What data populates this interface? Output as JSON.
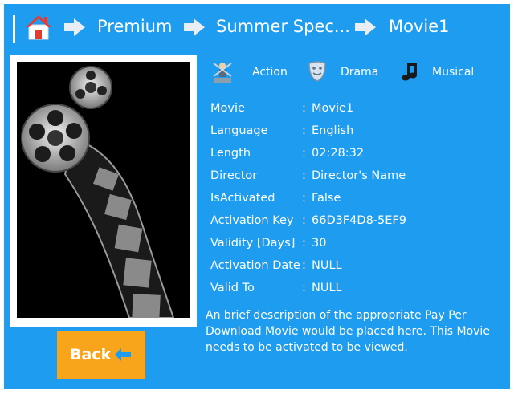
{
  "breadcrumb": {
    "items": [
      "Premium",
      "Summer Spec...",
      "Movie1"
    ]
  },
  "genres": [
    {
      "label": "Action",
      "icon": "action-figure-icon"
    },
    {
      "label": "Drama",
      "icon": "drama-mask-icon"
    },
    {
      "label": "Musical",
      "icon": "music-note-icon"
    }
  ],
  "details": [
    {
      "key": "Movie",
      "value": "Movie1"
    },
    {
      "key": "Language",
      "value": "English"
    },
    {
      "key": "Length",
      "value": "02:28:32"
    },
    {
      "key": "Director",
      "value": "Director's Name"
    },
    {
      "key": "IsActivated",
      "value": "False"
    },
    {
      "key": "Activation Key",
      "value": "66D3F4D8-5EF9"
    },
    {
      "key": "Validity [Days]",
      "value": "30"
    },
    {
      "key": "Activation Date",
      "value": "NULL"
    },
    {
      "key": "Valid To",
      "value": "NULL"
    }
  ],
  "separator": ":",
  "description": "An brief description of the appropriate Pay Per Download Movie would be placed here. This Movie needs to be activated to be viewed.",
  "back_label": "Back",
  "colors": {
    "background": "#1e9cf0",
    "accent": "#f9a51b",
    "text": "#ffffff"
  }
}
